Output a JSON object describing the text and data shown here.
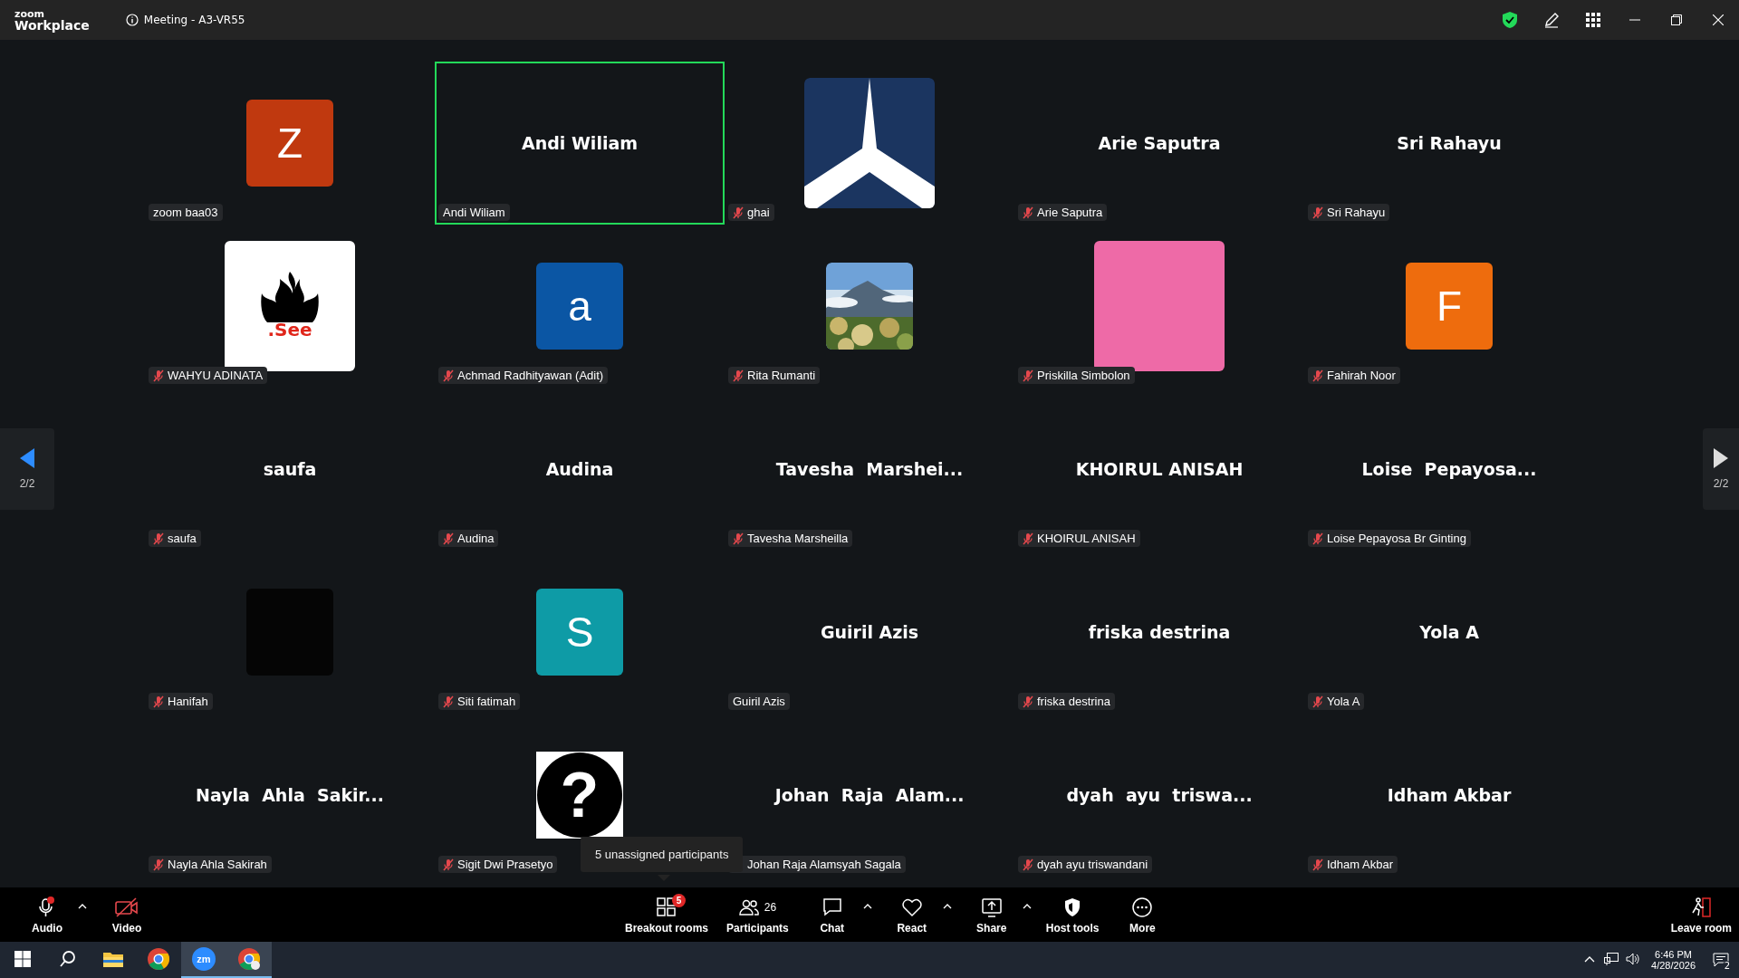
{
  "title_bar": {
    "logo_top": "zoom",
    "logo_bottom": "Workplace",
    "meeting_title": "Meeting - A3-VR55"
  },
  "pager": {
    "left_label": "2/2",
    "right_label": "2/2"
  },
  "tiles": [
    {
      "name": "zoom baa03",
      "kind": "letter",
      "letter": "Z",
      "color": "#c0390f",
      "muted": false,
      "selected": false
    },
    {
      "name": "Andi Wiliam",
      "kind": "name",
      "display": "Andi Wiliam",
      "muted": false,
      "selected": true
    },
    {
      "name": "ghai",
      "kind": "star",
      "muted": true,
      "selected": false
    },
    {
      "name": "Arie Saputra",
      "kind": "name",
      "display": "Arie Saputra",
      "muted": true,
      "selected": false
    },
    {
      "name": "Sri Rahayu",
      "kind": "name",
      "display": "Sri Rahayu",
      "muted": true,
      "selected": false
    },
    {
      "name": "WAHYU ADINATA",
      "kind": "flame",
      "logo_text": ".See",
      "muted": true,
      "selected": false
    },
    {
      "name": "Achmad Radhityawan (Adit)",
      "kind": "letter",
      "letter": "a",
      "color": "#0b56a4",
      "muted": true,
      "selected": false
    },
    {
      "name": "Rita Rumanti",
      "muted": true,
      "selected": false
    },
    {
      "name": "Priskilla Simbolon",
      "kind": "panel",
      "color": "#ee6aa7",
      "muted": true,
      "selected": false
    },
    {
      "name": "Fahirah Noor",
      "kind": "letter",
      "letter": "F",
      "color": "#ee6c0d",
      "muted": true,
      "selected": false
    },
    {
      "name": "saufa",
      "kind": "name",
      "display": "saufa",
      "muted": true,
      "selected": false
    },
    {
      "name": "Audina",
      "kind": "name",
      "display": "Audina",
      "muted": true,
      "selected": false
    },
    {
      "name": "Tavesha Marsheilla",
      "kind": "name",
      "display": "Tavesha  Marshei...",
      "muted": true,
      "selected": false
    },
    {
      "name": "KHOIRUL ANISAH",
      "kind": "name",
      "display": "KHOIRUL ANISAH",
      "muted": true,
      "selected": false
    },
    {
      "name": "Loise Pepayosa Br Ginting",
      "kind": "name",
      "display": "Loise  Pepayosa...",
      "muted": true,
      "selected": false
    },
    {
      "name": "Hanifah",
      "kind": "block",
      "color": "#050505",
      "muted": true,
      "selected": false
    },
    {
      "name": "Siti fatimah",
      "kind": "letter",
      "letter": "S",
      "color": "#0e9ba6",
      "muted": true,
      "selected": false
    },
    {
      "name": "Guiril Azis",
      "kind": "name",
      "display": "Guiril Azis",
      "muted": false,
      "selected": false
    },
    {
      "name": "friska destrina",
      "kind": "name",
      "display": "friska destrina",
      "muted": true,
      "selected": false
    },
    {
      "name": "Yola A",
      "kind": "name",
      "display": "Yola A",
      "muted": true,
      "selected": false
    },
    {
      "name": "Nayla Ahla Sakirah",
      "kind": "name",
      "display": "Nayla  Ahla  Sakir...",
      "muted": true,
      "selected": false
    },
    {
      "name": "Sigit Dwi Prasetyo",
      "kind": "question",
      "symbol": "?",
      "muted": true,
      "selected": false
    },
    {
      "name": "Johan Raja Alamsyah Sagala",
      "kind": "name",
      "display": "Johan  Raja  Alam...",
      "selected": false
    },
    {
      "name": "dyah ayu triswandani",
      "kind": "name",
      "display": "dyah  ayu  triswa...",
      "muted": true,
      "selected": false
    },
    {
      "name": "Idham Akbar",
      "kind": "name",
      "display": "Idham Akbar",
      "muted": true,
      "selected": false
    }
  ],
  "tooltip": "5 unassigned participants",
  "toolbar": {
    "left": [
      {
        "kind": "audio",
        "label": "Audio",
        "caret": true
      },
      {
        "kind": "video",
        "label": "Video",
        "caret": false
      }
    ],
    "center": [
      {
        "kind": "breakout",
        "label": "Breakout rooms",
        "badge": "5",
        "caret": false
      },
      {
        "kind": "participants",
        "label": "Participants",
        "count": "26",
        "caret": false
      },
      {
        "kind": "chat",
        "label": "Chat",
        "caret": true
      },
      {
        "kind": "react",
        "label": "React",
        "caret": true
      },
      {
        "kind": "share",
        "label": "Share",
        "caret": true
      },
      {
        "kind": "host",
        "label": "Host tools",
        "caret": false
      },
      {
        "kind": "more",
        "label": "More",
        "caret": false
      }
    ],
    "leave": {
      "label": "Leave room"
    }
  },
  "taskbar": {
    "apps": [
      {
        "kind": "explorer",
        "active": false
      },
      {
        "kind": "chrome",
        "active": false
      },
      {
        "kind": "zoom",
        "text": "zm",
        "active": true
      },
      {
        "kind": "chrome-profile",
        "active": true
      }
    ],
    "time": "6:46 PM",
    "date": "4/28/2026",
    "notifications": "2"
  }
}
